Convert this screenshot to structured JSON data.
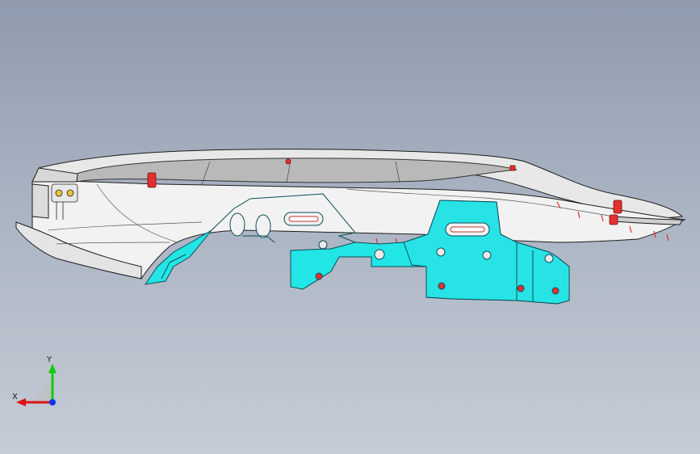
{
  "viewport": {
    "background_top": "#8f9bae",
    "background_bottom": "#c6ccd6"
  },
  "model": {
    "part_color": "#f2f2f2",
    "edge_color": "#1c1c1c",
    "selected_color": "#22e6e6",
    "marker_color": "#e23030"
  },
  "triad": {
    "x_label": "X",
    "y_label": "Y",
    "x_color": "#d11",
    "y_color": "#1c1",
    "z_color": "#13e"
  }
}
